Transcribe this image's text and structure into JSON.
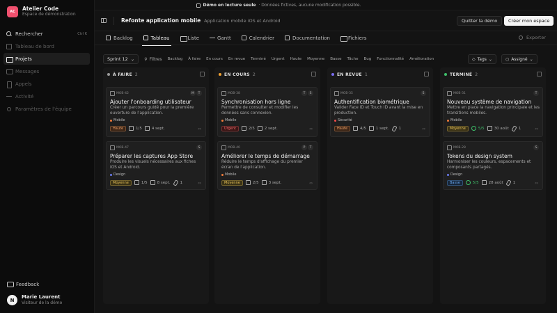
{
  "banner": {
    "strong": "Démo en lecture seule",
    "text": "· Données fictives, aucune modification possible."
  },
  "brand": {
    "initials": "AC",
    "name": "Atelier Code",
    "subtitle": "Espace de démonstration",
    "color": "#f0506e"
  },
  "nav": [
    {
      "label": "Rechercher",
      "kbd": "Ctrl K",
      "icon": "search-icon",
      "state": "normal"
    },
    {
      "label": "Tableau de bord",
      "icon": "dashboard-icon",
      "state": "dim"
    },
    {
      "label": "Projets",
      "icon": "folder-icon",
      "state": "active"
    },
    {
      "label": "Messages",
      "icon": "chat-icon",
      "state": "dim"
    },
    {
      "label": "Appels",
      "icon": "phone-icon",
      "state": "dim"
    },
    {
      "label": "Activité",
      "icon": "activity-icon",
      "state": "dim"
    },
    {
      "label": "Paramètres de l'équipe",
      "icon": "gear-icon",
      "state": "dim"
    }
  ],
  "feedback": "Feedback",
  "user": {
    "initial": "N",
    "name": "Marie Laurent",
    "role": "Visiteur de la démo"
  },
  "topbar": {
    "project": "Refonte application mobile",
    "project_sub": "Application mobile iOS et Android",
    "quit": "Quitter la démo",
    "create": "Créer mon espace"
  },
  "tabs": [
    "Backlog",
    "Tableau",
    "Liste",
    "Gantt",
    "Calendrier",
    "Documentation",
    "Fichiers"
  ],
  "active_tab": "Tableau",
  "export": "Exporter",
  "filters": {
    "sprint": "Sprint 12",
    "label": "Filtres",
    "chips": [
      "Backlog",
      "À faire",
      "En cours",
      "En revue",
      "Terminé",
      "Urgent",
      "Haute",
      "Moyenne",
      "Basse",
      "Tâche",
      "Bug",
      "Fonctionnalité",
      "Amélioration"
    ],
    "tags": "Tags",
    "assignee": "Assigné"
  },
  "columns": [
    {
      "title": "À FAIRE",
      "count": "2",
      "color": "#9a9a9a",
      "cards": [
        {
          "id": "MOB-42",
          "assignees": [
            "M",
            "T"
          ],
          "title": "Ajouter l'onboarding utilisateur",
          "desc": "Créer un parcours guidé pour la première ouverture de l'application.",
          "label": "Mobile",
          "label_color": "#f07a3a",
          "priority": "Haute",
          "prio_bg": "#3a2416",
          "prio_fg": "#f0a36a",
          "progress": "1/5",
          "date": "4 sept.",
          "attach": ""
        },
        {
          "id": "MOB-47",
          "assignees": [
            "S"
          ],
          "title": "Préparer les captures App Store",
          "desc": "Produire les visuels nécessaires aux fiches iOS et Android.",
          "label": "Design",
          "label_color": "#6a7cf0",
          "priority": "Moyenne",
          "prio_bg": "#3a3216",
          "prio_fg": "#e8c25a",
          "progress": "1/5",
          "date": "8 sept.",
          "attach": "1"
        }
      ]
    },
    {
      "title": "EN COURS",
      "count": "2",
      "color": "#f0a030",
      "cards": [
        {
          "id": "MOB-38",
          "assignees": [
            "T",
            "S"
          ],
          "title": "Synchronisation hors ligne",
          "desc": "Permettre de consulter et modifier les données sans connexion.",
          "label": "Mobile",
          "label_color": "#f07a3a",
          "priority": "Urgent",
          "prio_bg": "#3a1616",
          "prio_fg": "#f06a6a",
          "progress": "2/5",
          "date": "2 sept.",
          "attach": ""
        },
        {
          "id": "MOB-40",
          "assignees": [
            "P",
            "T"
          ],
          "title": "Améliorer le temps de démarrage",
          "desc": "Réduire le temps d'affichage du premier écran de l'application.",
          "label": "Mobile",
          "label_color": "#f07a3a",
          "priority": "Moyenne",
          "prio_bg": "#3a3216",
          "prio_fg": "#e8c25a",
          "progress": "2/5",
          "date": "3 sept.",
          "attach": ""
        }
      ]
    },
    {
      "title": "EN REVUE",
      "count": "1",
      "color": "#7a6cf0",
      "cards": [
        {
          "id": "MOB-35",
          "assignees": [
            "S"
          ],
          "title": "Authentification biométrique",
          "desc": "Valider Face ID et Touch ID avant la mise en production.",
          "label": "Sécurité",
          "label_color": "#f04a4a",
          "priority": "Haute",
          "prio_bg": "#3a2416",
          "prio_fg": "#f0a36a",
          "progress": "4/5",
          "date": "1 sept.",
          "attach": "1"
        }
      ]
    },
    {
      "title": "TERMINÉ",
      "count": "2",
      "color": "#3fbf6a",
      "cards": [
        {
          "id": "MOB-31",
          "assignees": [
            "T"
          ],
          "title": "Nouveau système de navigation",
          "desc": "Mettre en place la navigation principale et les transitions mobiles.",
          "label": "Mobile",
          "label_color": "#f07a3a",
          "priority": "Moyenne",
          "prio_bg": "#3a3216",
          "prio_fg": "#e8c25a",
          "progress": "5/5",
          "date": "30 août",
          "attach": "1",
          "done": true
        },
        {
          "id": "MOB-28",
          "assignees": [
            "S"
          ],
          "title": "Tokens du design system",
          "desc": "Harmoniser les couleurs, espacements et composants partagés.",
          "label": "Design",
          "label_color": "#6a7cf0",
          "priority": "Basse",
          "prio_bg": "#16263a",
          "prio_fg": "#6aa8f0",
          "progress": "5/5",
          "date": "28 août",
          "attach": "1",
          "done": true
        }
      ]
    }
  ]
}
